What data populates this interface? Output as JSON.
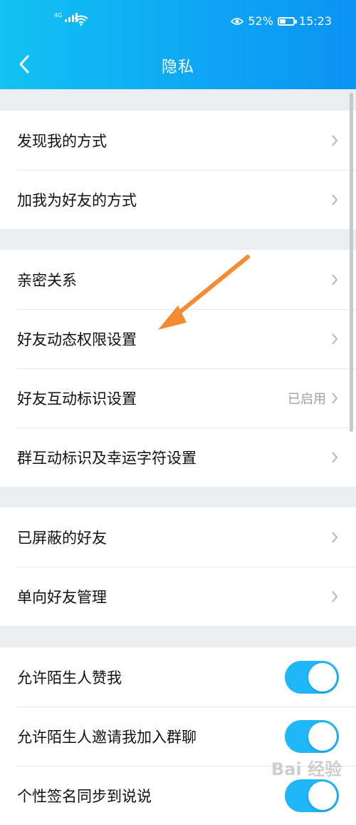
{
  "status": {
    "network": "4G",
    "battery": "52%",
    "battery_level": 0.52,
    "time": "15:23"
  },
  "header": {
    "title": "隐私"
  },
  "groups": [
    {
      "items": [
        {
          "label": "发现我的方式"
        },
        {
          "label": "加我为好友的方式"
        }
      ]
    },
    {
      "items": [
        {
          "label": "亲密关系"
        },
        {
          "label": "好友动态权限设置"
        },
        {
          "label": "好友互动标识设置",
          "value": "已启用"
        },
        {
          "label": "群互动标识及幸运字符设置"
        }
      ]
    },
    {
      "items": [
        {
          "label": "已屏蔽的好友"
        },
        {
          "label": "单向好友管理"
        }
      ]
    },
    {
      "items": [
        {
          "label": "允许陌生人赞我",
          "toggle": "on"
        },
        {
          "label": "允许陌生人邀请我加入群聊",
          "toggle": "on"
        },
        {
          "label": "个性签名同步到说说",
          "toggle": "on"
        }
      ]
    }
  ],
  "annotation": {
    "color": "#f58b33"
  },
  "watermark": "Bai 经验",
  "icons": {
    "back": "chevron-left-icon",
    "row": "chevron-right-icon",
    "eye": "eye-icon",
    "wifi": "wifi-icon",
    "battery": "battery-icon"
  },
  "colors": {
    "header": "#0ea7f5",
    "toggle_on": "#1fb7f7",
    "background": "#ebedf0"
  }
}
